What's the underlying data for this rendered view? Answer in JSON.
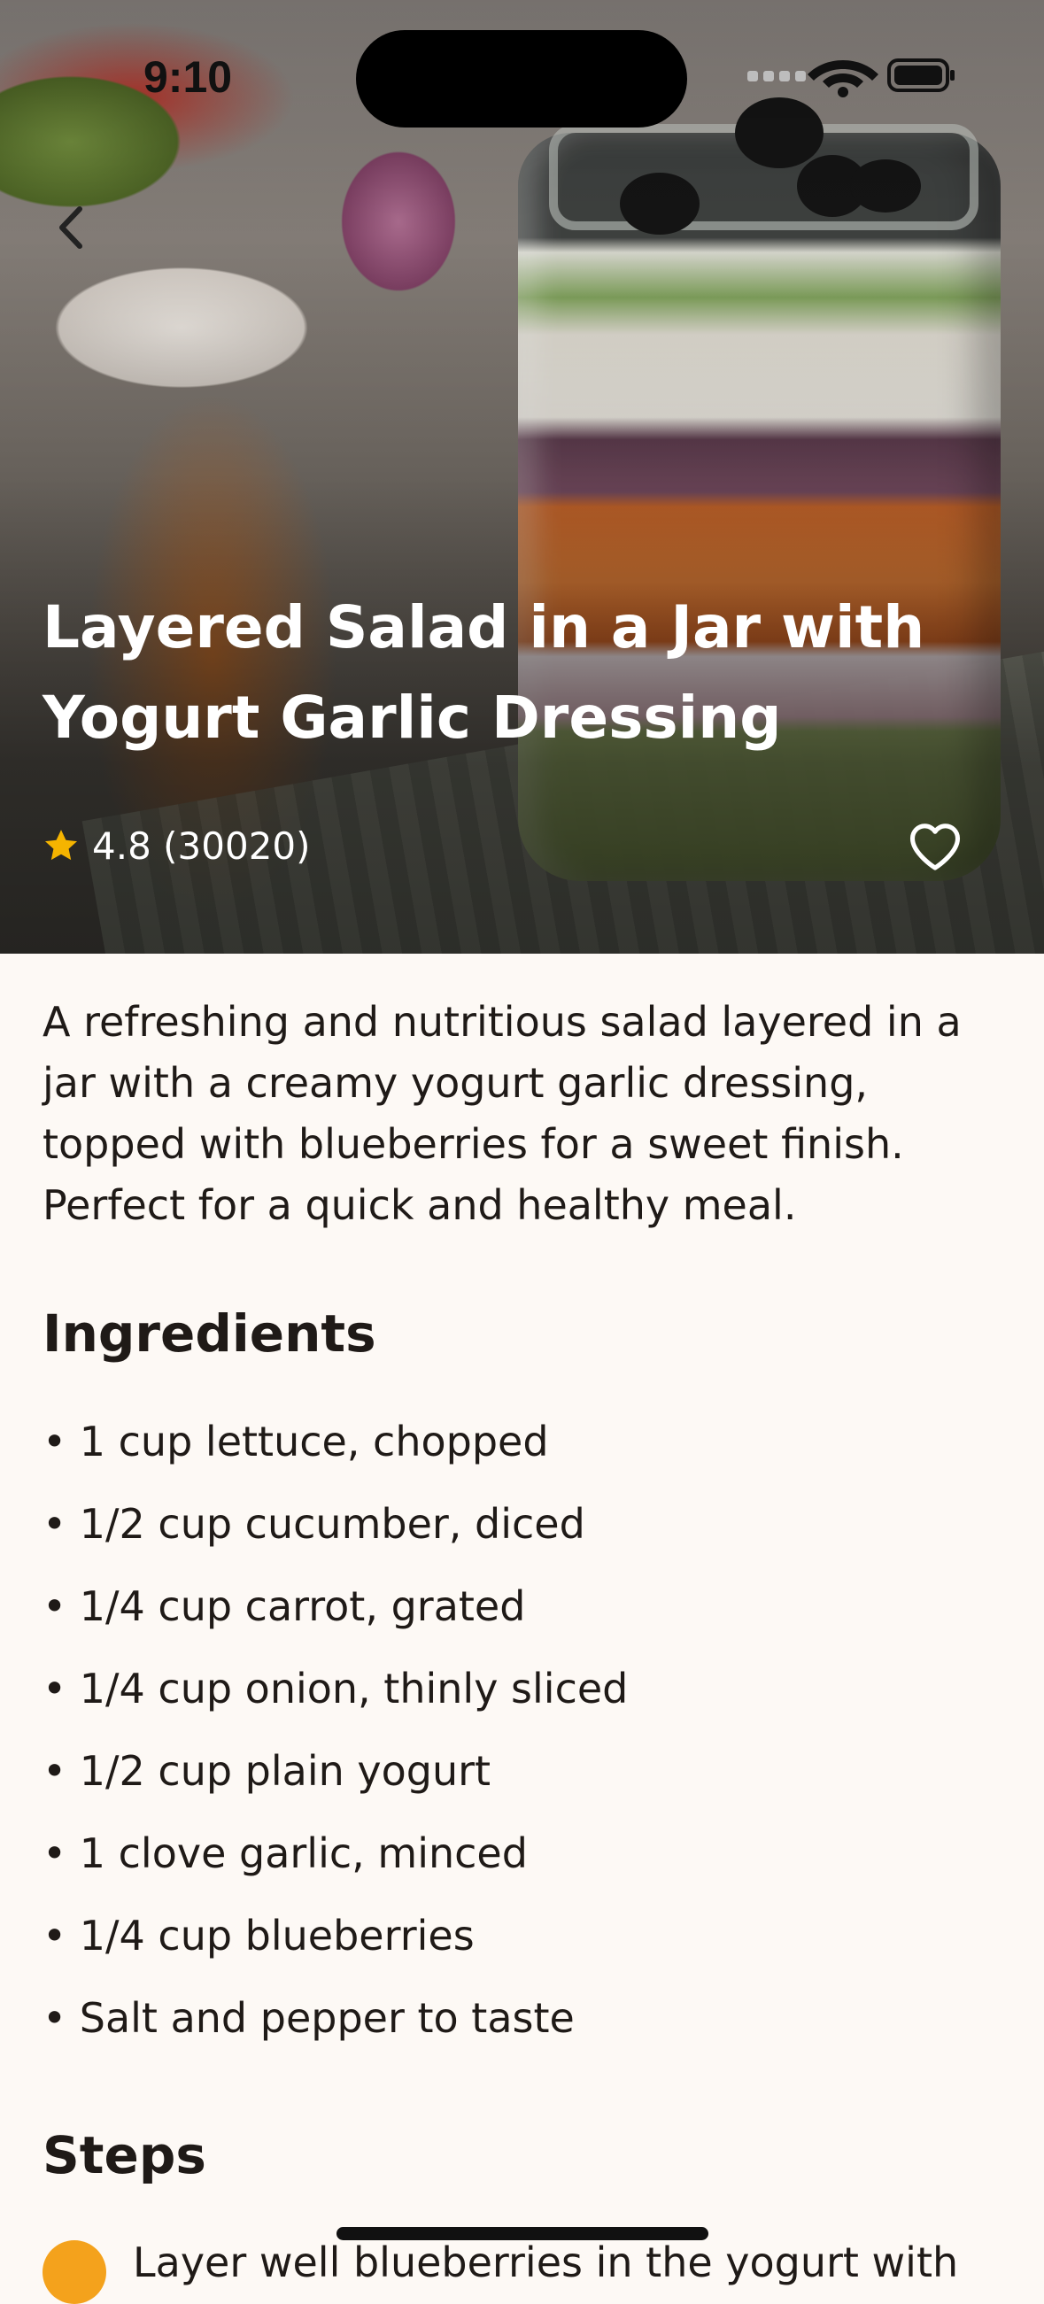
{
  "status_bar": {
    "time": "9:10"
  },
  "recipe": {
    "title": "Layered Salad in a Jar with Yogurt Garlic Dressing",
    "rating": "4.8 (30020)",
    "description": "A refreshing and nutritious salad layered in a jar with a creamy yogurt garlic dressing, topped with blueberries for a sweet finish. Perfect for a quick and healthy meal."
  },
  "ingredients": {
    "title": "Ingredients",
    "items": [
      "• 1 cup lettuce, chopped",
      "• 1/2 cup cucumber, diced",
      "• 1/4 cup carrot, grated",
      "• 1/4 cup onion, thinly sliced",
      "• 1/2 cup plain yogurt",
      "• 1 clove garlic, minced",
      "• 1/4 cup blueberries",
      "• Salt and pepper to taste"
    ]
  },
  "steps": {
    "title": "Steps",
    "first_step_partial": "Layer well blueberries in the yogurt with"
  },
  "icons": {
    "back": "chevron-left-icon",
    "favorite": "heart-outline-icon",
    "rating": "star-icon"
  },
  "colors": {
    "background": "#FDF9F5",
    "accent": "#F4A21C",
    "star": "#F5B400"
  }
}
